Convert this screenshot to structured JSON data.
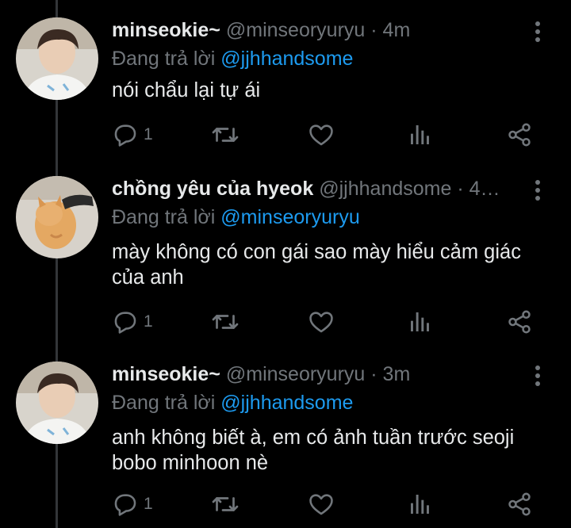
{
  "colors": {
    "background": "#000000",
    "text": "#e7e9ea",
    "muted": "#71767b",
    "link": "#1d9bf0",
    "thread_line": "#333639"
  },
  "reply_prefix": "Đang trả lời",
  "tweets": [
    {
      "display_name": "minseokie~",
      "meta": "@minseoryuryu · 4m",
      "reply_to": "@jjhhandsome",
      "text": "nói chẩu lại tự ái",
      "reply_count": "1",
      "avatar_icon": "person-avatar-icon"
    },
    {
      "display_name": "chồng yêu của hyeok",
      "meta": "@jjhhandsome · 4…",
      "reply_to": "@minseoryuryu",
      "text": "mày không có con gái sao mày hiểu cảm giác của anh",
      "reply_count": "1",
      "avatar_icon": "cat-avatar-icon"
    },
    {
      "display_name": "minseokie~",
      "meta": "@minseoryuryu · 3m",
      "reply_to": "@jjhhandsome",
      "text": "anh không biết à, em có ảnh tuần trước seoji bobo minhoon nè",
      "reply_count": "1",
      "avatar_icon": "person-avatar-icon"
    }
  ],
  "action_icons": [
    "reply-icon",
    "retweet-icon",
    "like-icon",
    "analytics-icon",
    "share-icon"
  ]
}
